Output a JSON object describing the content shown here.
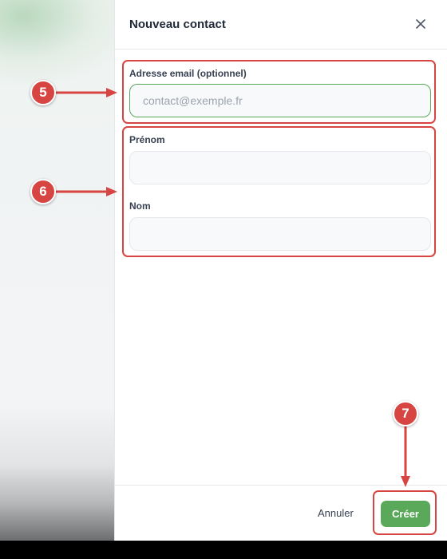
{
  "dialog": {
    "title": "Nouveau contact",
    "close_icon": "close-icon"
  },
  "form": {
    "email": {
      "label": "Adresse email (optionnel)",
      "placeholder": "contact@exemple.fr",
      "value": ""
    },
    "first_name": {
      "label": "Prénom",
      "value": ""
    },
    "last_name": {
      "label": "Nom",
      "value": ""
    }
  },
  "footer": {
    "cancel_label": "Annuler",
    "create_label": "Créer"
  },
  "annotations": {
    "step_email": "5",
    "step_names": "6",
    "step_create": "7"
  },
  "colors": {
    "accent": "#5aa85a",
    "annotation": "#d64541"
  }
}
